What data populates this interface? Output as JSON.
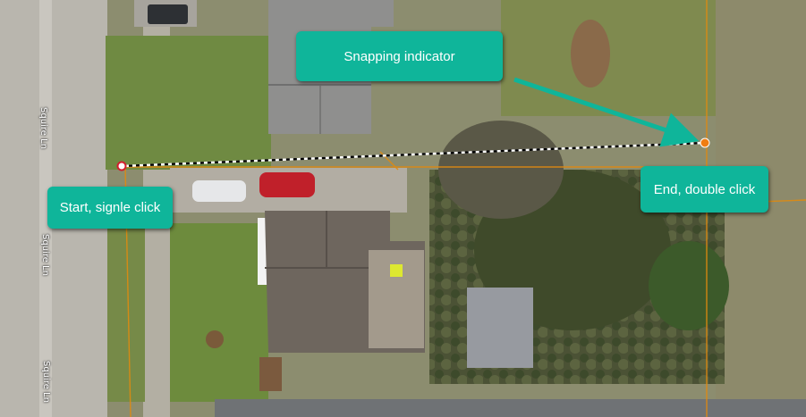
{
  "map": {
    "street_name": "Squire Ln",
    "street_labels": [
      "Squire Ln",
      "Squire Ln",
      "Squire Ln"
    ]
  },
  "callouts": {
    "snapping": "Snapping indicator",
    "start": "Start, signle click",
    "end": "End, double click"
  },
  "measure_line": {
    "start_marker": "red-ring-vertex",
    "end_marker": "orange-snap-vertex",
    "style": "dashed black-and-white"
  },
  "colors": {
    "callout_bg": "#0fb59a",
    "callout_text": "#ffffff",
    "parcel_line": "#e08a10",
    "snap_dot": "#f07d12",
    "start_dot": "#d21e2d",
    "grass": "#6b8a3c",
    "road": "#b9b6ae"
  }
}
